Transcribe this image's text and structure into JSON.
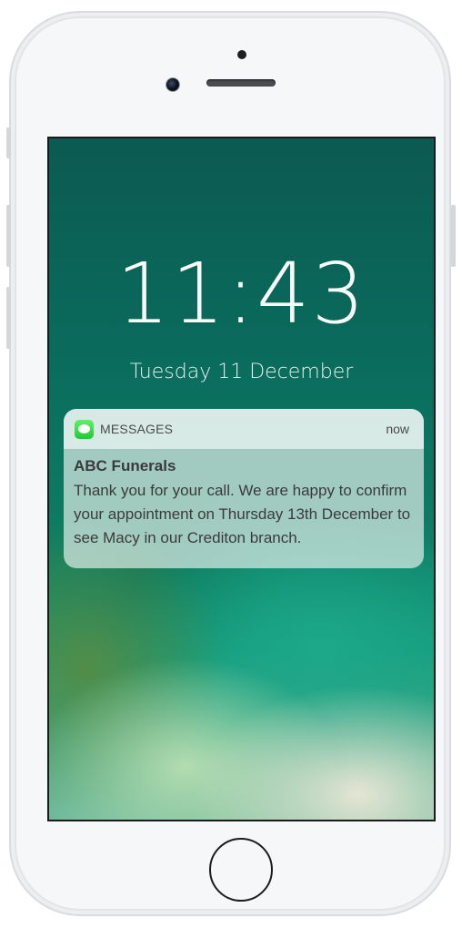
{
  "lock_screen": {
    "time": "11:43",
    "date": "Tuesday 11 December"
  },
  "notification": {
    "app_icon": "messages-app-icon",
    "app_name": "MESSAGES",
    "time": "now",
    "sender": "ABC Funerals",
    "body": "Thank you for your call. We are happy to confirm your appointment on Thursday 13th December to see Macy in our Crediton branch."
  },
  "colors": {
    "messages_icon_green": "#2fd94a",
    "wallpaper_teal": "#0a6a5c",
    "notification_text": "#3a3a3a"
  }
}
